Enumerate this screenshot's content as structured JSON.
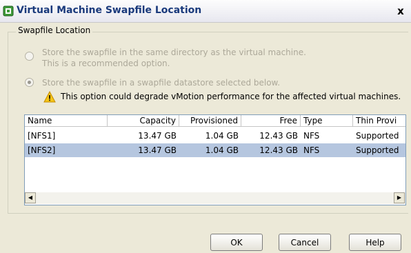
{
  "window": {
    "title": "Virtual Machine Swapfile Location",
    "close_label": "x"
  },
  "group": {
    "legend": "Swapfile Location"
  },
  "options": [
    {
      "label_line1": "Store the swapfile in the same directory as the virtual machine.",
      "label_line2": "This is a recommended option.",
      "selected": false,
      "enabled": false
    },
    {
      "label_line1": "Store the swapfile in a swapfile datastore selected below.",
      "selected": true,
      "enabled": false
    }
  ],
  "warning": {
    "icon": "warning-icon",
    "text": "This option could degrade vMotion performance for the affected virtual machines."
  },
  "table": {
    "columns": [
      "Name",
      "Capacity",
      "Provisioned",
      "Free",
      "Type",
      "Thin Provi"
    ],
    "rows": [
      {
        "name": "[NFS1]",
        "capacity": "13.47 GB",
        "provisioned": "1.04 GB",
        "free": "12.43 GB",
        "type": "NFS",
        "thin": "Supported",
        "selected": false
      },
      {
        "name": "[NFS2]",
        "capacity": "13.47 GB",
        "provisioned": "1.04 GB",
        "free": "12.43 GB",
        "type": "NFS",
        "thin": "Supported",
        "selected": true
      }
    ]
  },
  "buttons": {
    "ok": "OK",
    "cancel": "Cancel",
    "help": "Help"
  },
  "colors": {
    "title_text": "#1a3a7c",
    "selection": "#b5c6df",
    "disabled_text": "#aca899",
    "dialog_bg": "#ece9d8"
  }
}
